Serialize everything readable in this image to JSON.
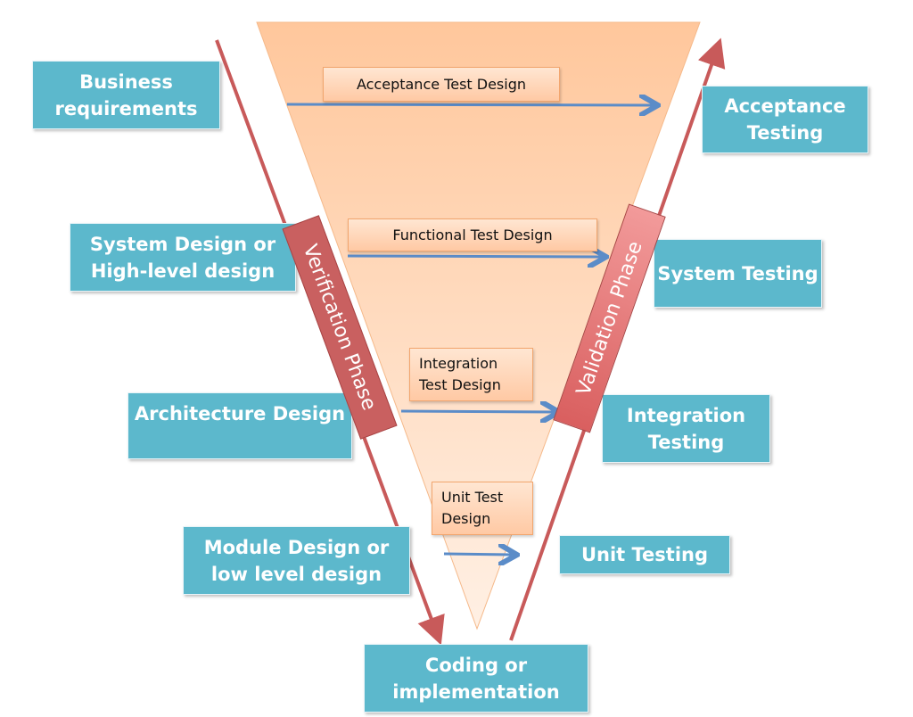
{
  "colors": {
    "box": "#5cb8cc",
    "funnel": "#ffc9a0",
    "phase_arrow": "#c85a5a",
    "test_arrow": "#5b8cc8"
  },
  "left_boxes": [
    "Business requirements",
    "System Design or High-level design",
    "Architecture Design",
    "Module Design or low level design"
  ],
  "right_boxes": [
    "Acceptance Testing",
    "System Testing",
    "Integration Testing",
    "Unit Testing"
  ],
  "bottom_box": "Coding or implementation",
  "test_designs": [
    "Acceptance Test Design",
    "Functional Test Design",
    "Integration Test Design",
    "Unit Test Design"
  ],
  "phases": {
    "left": "Verification Phase",
    "right": "Validation Phase"
  }
}
